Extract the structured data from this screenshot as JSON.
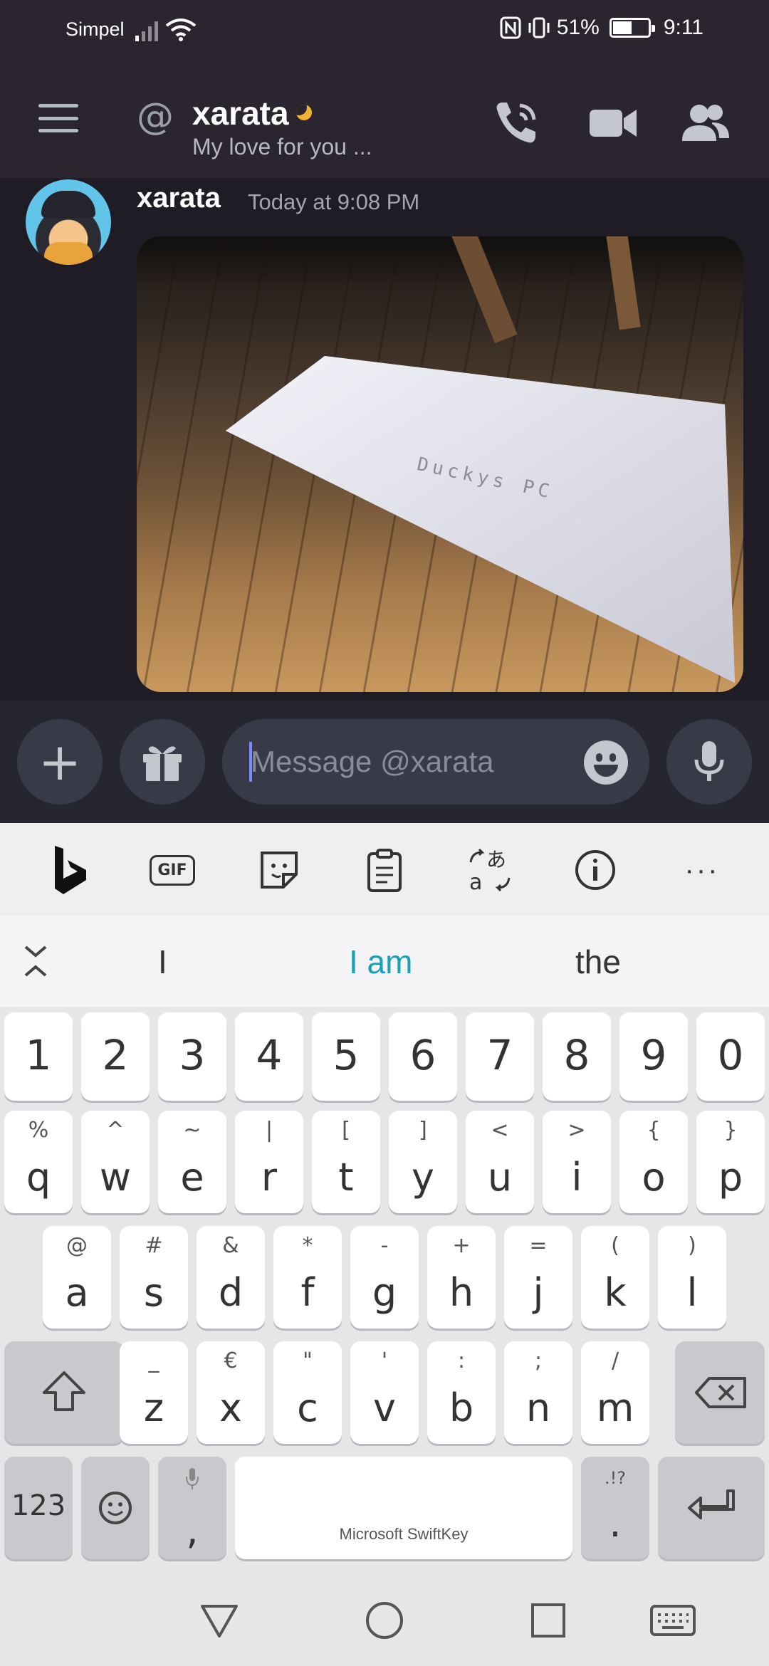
{
  "status_bar": {
    "carrier": "Simpel",
    "battery": "51%",
    "time": "9:11",
    "battery_level": 0.51
  },
  "header": {
    "name": "xarata",
    "status": "My love for you ..."
  },
  "message": {
    "author": "xarata",
    "timestamp": "Today at 9:08 PM",
    "attachment_text": "Duckys PC"
  },
  "composer": {
    "placeholder": "Message @xarata"
  },
  "keyboard": {
    "suggestions": [
      "I",
      "I am",
      "the"
    ],
    "number_row": [
      "1",
      "2",
      "3",
      "4",
      "5",
      "6",
      "7",
      "8",
      "9",
      "0"
    ],
    "row1": [
      {
        "key": "q",
        "alt": "%"
      },
      {
        "key": "w",
        "alt": "^"
      },
      {
        "key": "e",
        "alt": "~"
      },
      {
        "key": "r",
        "alt": "|"
      },
      {
        "key": "t",
        "alt": "["
      },
      {
        "key": "y",
        "alt": "]"
      },
      {
        "key": "u",
        "alt": "<"
      },
      {
        "key": "i",
        "alt": ">"
      },
      {
        "key": "o",
        "alt": "{"
      },
      {
        "key": "p",
        "alt": "}"
      }
    ],
    "row2": [
      {
        "key": "a",
        "alt": "@"
      },
      {
        "key": "s",
        "alt": "#"
      },
      {
        "key": "d",
        "alt": "&"
      },
      {
        "key": "f",
        "alt": "*"
      },
      {
        "key": "g",
        "alt": "-"
      },
      {
        "key": "h",
        "alt": "+"
      },
      {
        "key": "j",
        "alt": "="
      },
      {
        "key": "k",
        "alt": "("
      },
      {
        "key": "l",
        "alt": ")"
      }
    ],
    "row3": [
      {
        "key": "z",
        "alt": "_"
      },
      {
        "key": "x",
        "alt": "€"
      },
      {
        "key": "c",
        "alt": "\""
      },
      {
        "key": "v",
        "alt": "'"
      },
      {
        "key": "b",
        "alt": ":"
      },
      {
        "key": "n",
        "alt": ";"
      },
      {
        "key": "m",
        "alt": "/"
      }
    ],
    "numbers_key": "123",
    "comma_key": ",",
    "period_key": ".",
    "period_alt": ".!?",
    "space_label": "Microsoft SwiftKey"
  }
}
